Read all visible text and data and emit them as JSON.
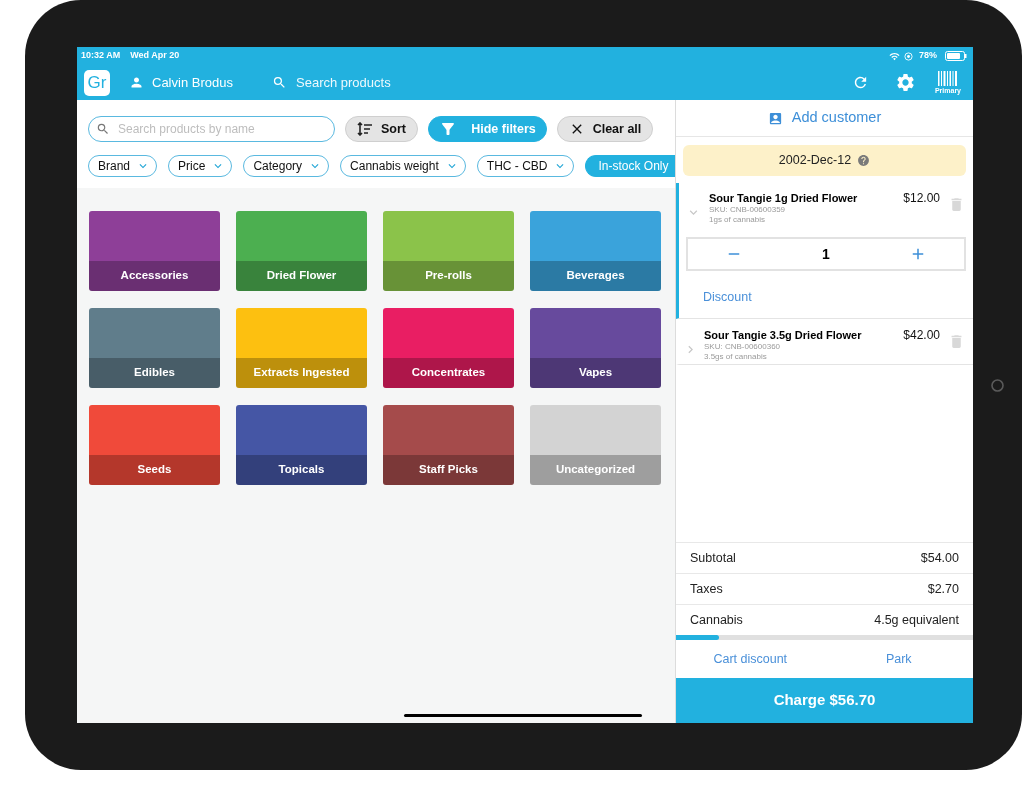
{
  "status_bar": {
    "time": "10:32 AM",
    "date": "Wed Apr 20",
    "battery": "78%"
  },
  "app_bar": {
    "logo": "Gr",
    "user": "Calvin Brodus",
    "search": {
      "placeholder": "Search products"
    },
    "barcode_label": "Primary"
  },
  "catalog": {
    "search": {
      "placeholder": "Search products by name"
    },
    "actions": [
      {
        "kind": "sort",
        "label": "Sort"
      },
      {
        "kind": "filter",
        "label": "Hide filters"
      },
      {
        "kind": "clear",
        "label": "Clear all"
      }
    ],
    "filters": [
      {
        "kind": "dropdown",
        "label": "Brand",
        "selected": false
      },
      {
        "kind": "dropdown",
        "label": "Price",
        "selected": false
      },
      {
        "kind": "dropdown",
        "label": "Category",
        "selected": false
      },
      {
        "kind": "dropdown",
        "label": "Cannabis weight",
        "selected": false
      },
      {
        "kind": "dropdown",
        "label": "THC - CBD",
        "selected": false
      },
      {
        "kind": "toggle",
        "label": "In-stock Only",
        "selected": true
      }
    ],
    "categories": [
      {
        "name": "Accessories",
        "color": "#8e3f98"
      },
      {
        "name": "Dried Flower",
        "color": "#4caf50"
      },
      {
        "name": "Pre-rolls",
        "color": "#8bc34a"
      },
      {
        "name": "Beverages",
        "color": "#3aa3db"
      },
      {
        "name": "Edibles",
        "color": "#607d8b"
      },
      {
        "name": "Extracts Ingested",
        "color": "#fdc010"
      },
      {
        "name": "Concentrates",
        "color": "#e91e63"
      },
      {
        "name": "Vapes",
        "color": "#674a9d"
      },
      {
        "name": "Seeds",
        "color": "#f04a3a"
      },
      {
        "name": "Topicals",
        "color": "#4556a5"
      },
      {
        "name": "Staff Picks",
        "color": "#a54b4b"
      },
      {
        "name": "Uncategorized",
        "color": "#d3d3d3"
      }
    ]
  },
  "cart": {
    "add_customer": "Add customer",
    "birthdate": "2002-Dec-12",
    "items": [
      {
        "name": "Sour Tangie 1g Dried Flower",
        "sku": "SKU: CNB-00600359",
        "cannabis": "1gs of cannabis",
        "price": "$12.00",
        "expanded": true,
        "quantity": "1",
        "discount": "Discount"
      },
      {
        "name": "Sour Tangie 3.5g Dried Flower",
        "sku": "SKU: CNB-00600360",
        "cannabis": "3.5gs of cannabis",
        "price": "$42.00",
        "expanded": false
      }
    ],
    "totals": [
      {
        "label": "Subtotal",
        "value": "$54.00"
      },
      {
        "label": "Taxes",
        "value": "$2.70"
      },
      {
        "label": "Cannabis",
        "value": "4.5g equivalent"
      }
    ],
    "cannabis_limit": {
      "level": 0.145
    },
    "links": [
      "Cart discount",
      "Park"
    ],
    "charge": "Charge $56.70"
  }
}
